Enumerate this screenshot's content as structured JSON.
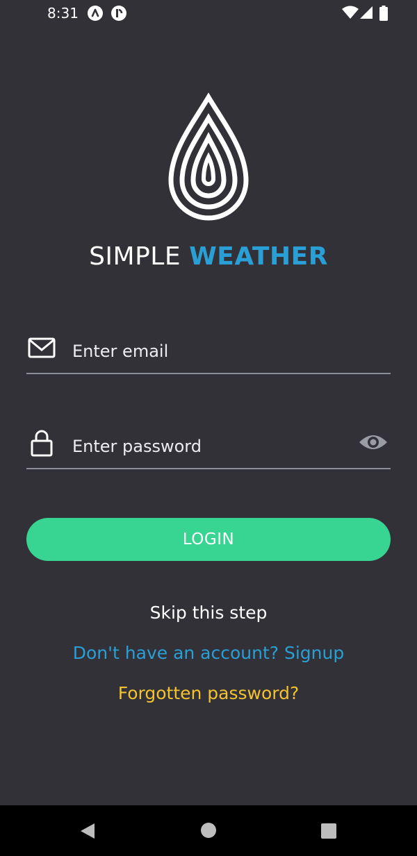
{
  "status_bar": {
    "time": "8:31",
    "icons": [
      "app-notification-icon",
      "app-notification-icon",
      "wifi-icon",
      "signal-icon",
      "battery-icon"
    ]
  },
  "brand": {
    "logo_icon": "water-drop-icon",
    "name_part1": "SIMPLE",
    "name_part2": "WEATHER",
    "accent_color": "#2a9fd6"
  },
  "form": {
    "email": {
      "icon": "mail-icon",
      "placeholder": "Enter email",
      "value": ""
    },
    "password": {
      "icon": "lock-icon",
      "placeholder": "Enter password",
      "value": "",
      "toggle_icon": "eye-icon"
    },
    "login_label": "LOGIN",
    "login_color": "#38d492"
  },
  "links": {
    "skip": "Skip this step",
    "signup": "Don't have an account? Signup",
    "forgot": "Forgotten password?"
  },
  "nav_bar": {
    "back": "back-icon",
    "home": "home-icon",
    "recents": "recents-icon"
  },
  "colors": {
    "background": "#323137",
    "link_blue": "#2a9fd6",
    "link_yellow": "#f3c230"
  }
}
